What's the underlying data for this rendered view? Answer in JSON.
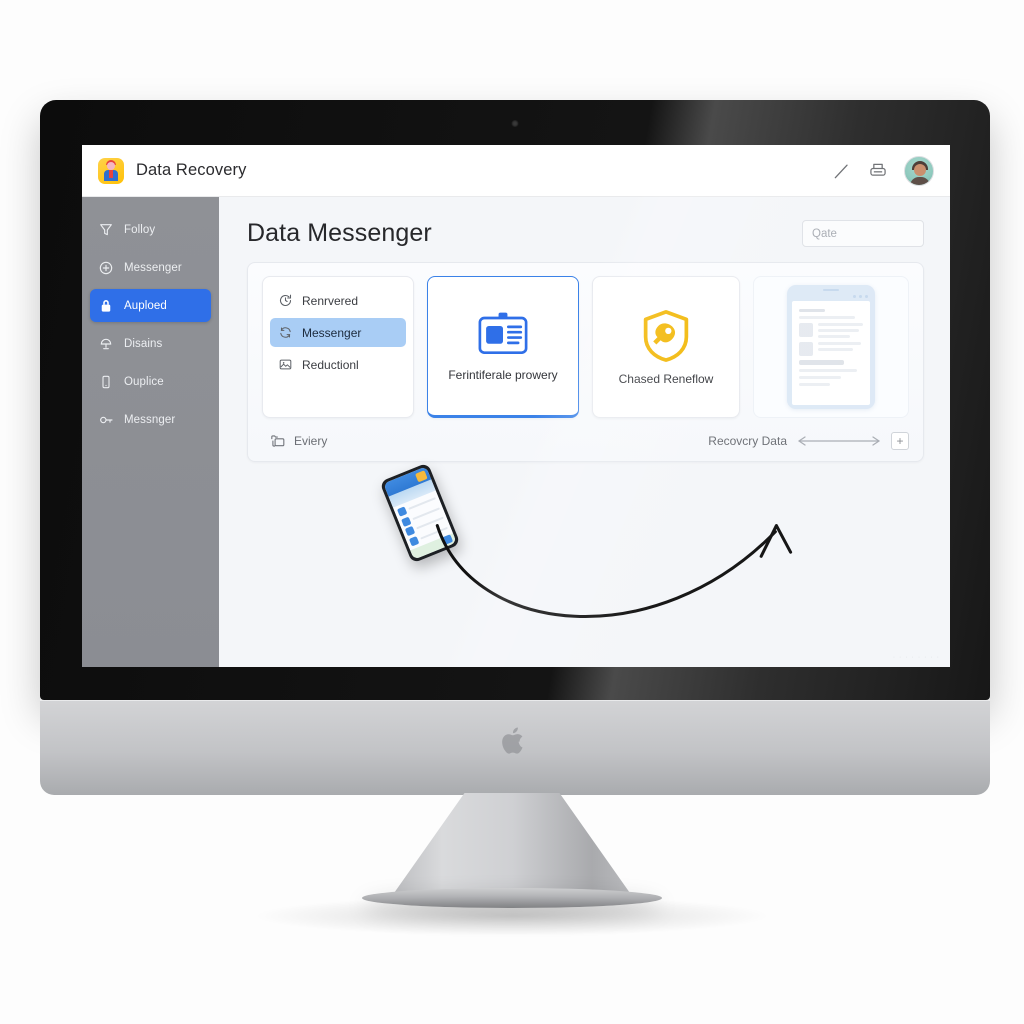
{
  "window": {
    "app_title": "Data Recovery",
    "logo_icon": "app-avatar-logo-icon"
  },
  "titlebar": {
    "actions": [
      {
        "icon": "pencil-edit-icon",
        "name": "edit-button"
      },
      {
        "icon": "printer-icon",
        "name": "print-button"
      }
    ],
    "avatar_icon": "user-avatar"
  },
  "sidebar": {
    "items": [
      {
        "label": "Folloy",
        "icon": "funnel-icon",
        "active": false
      },
      {
        "label": "Messenger",
        "icon": "plus-circle-icon",
        "active": false
      },
      {
        "label": "Auploed",
        "icon": "lock-icon",
        "active": true
      },
      {
        "label": "Disains",
        "icon": "lamp-icon",
        "active": false
      },
      {
        "label": "Ouplice",
        "icon": "mobile-phone-icon",
        "active": false
      },
      {
        "label": "Messnger",
        "icon": "key-icon",
        "active": false
      }
    ]
  },
  "main": {
    "page_title": "Data Messenger",
    "search": {
      "value": "",
      "placeholder": "Qate"
    },
    "list_card": {
      "rows": [
        {
          "label": "Renrvered",
          "icon": "clock-history-icon",
          "selected": false
        },
        {
          "label": "Messenger",
          "icon": "refresh-sync-icon",
          "selected": true
        },
        {
          "label": "Reductionl",
          "icon": "image-icon",
          "selected": false
        }
      ]
    },
    "feature_card": {
      "label": "Ferintiferale prowery",
      "icon": "id-card-icon"
    },
    "shield_card": {
      "label": "Chased Reneflow",
      "icon": "shield-pen-icon"
    },
    "preview_card": {
      "icon": "tablet-document-preview-icon"
    },
    "panel_bar": {
      "left_label": "Eviery",
      "left_icon": "duplicate-files-icon",
      "right_label": "Recovcry Data",
      "arrow_icon": "double-arrow-icon",
      "plus_label": "+"
    },
    "stage": {
      "phone_icon": "smartphone-device-icon",
      "arrow_icon": "curved-arrow-icon",
      "corner_mark": "· · · · · · · ·"
    }
  },
  "hardware": {
    "webcam_icon": "webcam-dot-icon",
    "brand_logo_icon": "apple-logo-icon"
  },
  "colors": {
    "accent_blue": "#2f6fe8",
    "card_border_blue": "#3b82e8",
    "selected_row": "#a9cdf5",
    "shield_gold": "#f2b705",
    "sidebar_gray": "#8f9196",
    "page_bg": "#f4f6f9"
  }
}
